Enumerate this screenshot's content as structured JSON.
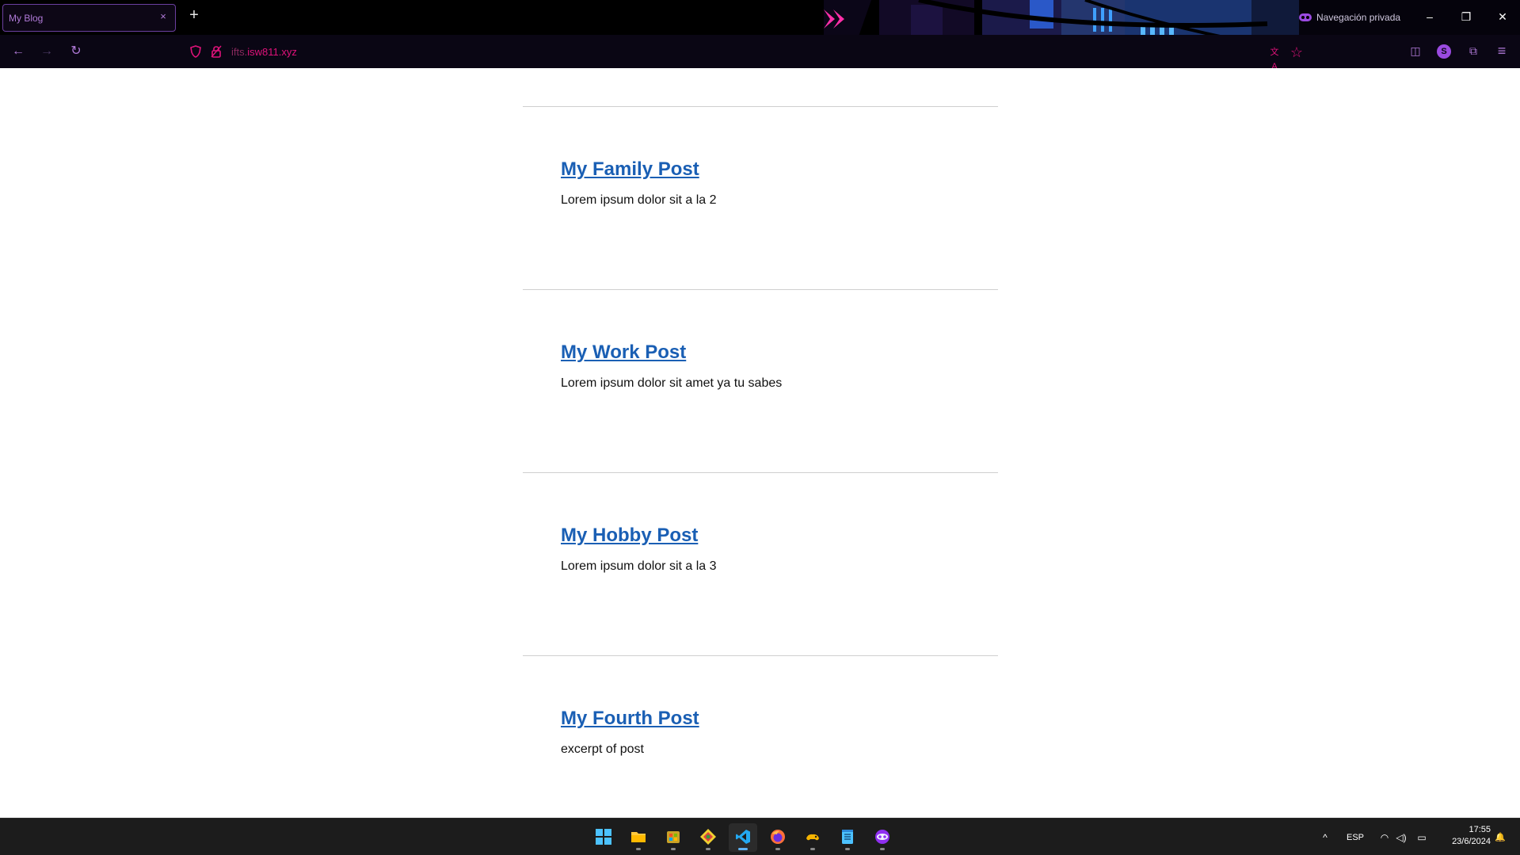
{
  "browser": {
    "tab": {
      "title": "My Blog",
      "close_glyph": "×"
    },
    "new_tab_glyph": "+",
    "private_label": "Navegación privada",
    "window_controls": {
      "minimize": "–",
      "restore": "❐",
      "close": "✕"
    },
    "nav": {
      "back": "←",
      "forward": "→",
      "reload": "↻"
    },
    "url": {
      "subdomain": "ifts.",
      "domain": "isw811.xyz"
    },
    "url_actions": {
      "translate": "文A",
      "bookmark": "☆"
    },
    "toolbar": {
      "pocket": "◫",
      "account_initial": "S",
      "extensions": "⧉",
      "menu": "≡"
    },
    "accent_color": "#e0127a",
    "theme_color": "#9a4ae0"
  },
  "posts": [
    {
      "title": "My Family Post",
      "excerpt": "Lorem ipsum dolor sit a la 2"
    },
    {
      "title": "My Work Post",
      "excerpt": "Lorem ipsum dolor sit amet ya tu sabes"
    },
    {
      "title": "My Hobby Post",
      "excerpt": "Lorem ipsum dolor sit a la 3"
    },
    {
      "title": "My Fourth Post",
      "excerpt": "excerpt of post"
    }
  ],
  "link_color": "#1a5fb4",
  "taskbar": {
    "apps": [
      "windows-start",
      "file-explorer",
      "app-store",
      "git-client",
      "vs-code",
      "firefox",
      "gaming-app",
      "notepad",
      "firefox-private"
    ],
    "tray": {
      "chevron": "^",
      "language": "ESP",
      "wifi": "◠",
      "volume": "◁)",
      "battery": "▭"
    },
    "clock": {
      "time": "17:55",
      "date": "23/6/2024"
    },
    "notification_glyph": "🔔"
  }
}
